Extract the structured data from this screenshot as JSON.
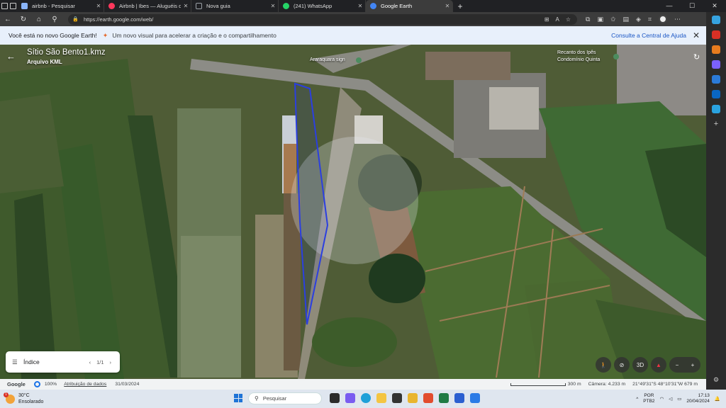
{
  "browser": {
    "tabs": [
      {
        "title": "airbnb - Pesquisar",
        "color": "#8ab4f8"
      },
      {
        "title": "Airbnb | Ibes — Aluguéis de féri",
        "color": "#ff385c"
      },
      {
        "title": "Nova guia",
        "color": "#9aa0a6"
      },
      {
        "title": "(241) WhatsApp",
        "color": "#25d366"
      },
      {
        "title": "Google Earth",
        "color": "#4285f4"
      }
    ],
    "new_tab": "+",
    "url": "https://earth.google.com/web/"
  },
  "infobar": {
    "bold_text": "Você está no novo Google Earth!",
    "text": "Um novo visual para acelerar a criação e o compartilhamento",
    "link": "Consulte a Central de Ajuda"
  },
  "earth": {
    "title": "Sítio São Bento1.kmz",
    "subtitle": "Arquivo KML",
    "places": {
      "araraquara": "Araraquara sign",
      "recanto_1": "Recanto dos Ipês",
      "recanto_2": "Condomínio Quinta"
    },
    "index_panel": {
      "label": "Índice",
      "page": "1/1"
    },
    "controls": {
      "three_d": "3D",
      "zoom_out": "−",
      "zoom_in": "+"
    }
  },
  "status": {
    "brand": "Google",
    "zoom_pct": "100%",
    "attribution": "Atribuição de dados",
    "date": "31/03/2024",
    "scale": "300 m",
    "camera": "Câmera: 4.233 m",
    "coords": "21°49'31\"S 48°10'31\"W  679 m"
  },
  "taskbar": {
    "temp": "30°C",
    "condition": "Ensolarado",
    "notif": "1",
    "search_placeholder": "Pesquisar",
    "lang_1": "POR",
    "lang_2": "PTB2",
    "time": "17:13",
    "date": "20/04/2024"
  },
  "colors": {
    "kml_outline": "#2b3fe0",
    "accent": "#1a73e8"
  }
}
